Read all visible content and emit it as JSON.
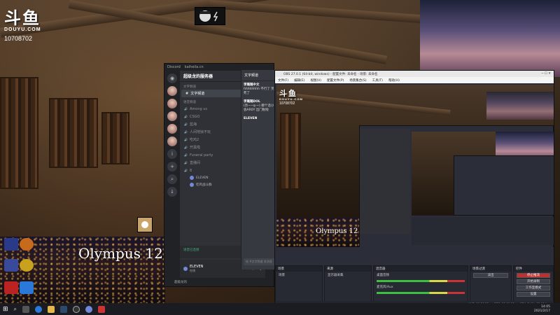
{
  "douyu": {
    "logo": "斗鱼",
    "domain": "DOUYU.COM",
    "room_id": "10708702"
  },
  "stream_overlay": {
    "title_text": "Olympus 12 I"
  },
  "discord": {
    "window_title": "Discord",
    "window_url": "kaiheila.cn",
    "server_name": "超级龙的服务器",
    "category_text": "文字频道",
    "category_voice": "语音频道",
    "text_channels": [
      {
        "name": "文字频道",
        "count": ""
      }
    ],
    "voice_channels": [
      {
        "name": "Among us",
        "count": "00/00"
      },
      {
        "name": "CSGO",
        "count": "00/00"
      },
      {
        "name": "蓝海",
        "count": "00/00"
      },
      {
        "name": "人间地狱不玩",
        "count": "00/00"
      },
      {
        "name": "吃鸡2",
        "count": "00/00"
      },
      {
        "name": "开黑啦",
        "count": "00/00"
      },
      {
        "name": "Funeral party",
        "count": "00/00"
      },
      {
        "name": "直播间",
        "count": "00/00"
      },
      {
        "name": "8",
        "count": "00/00"
      }
    ],
    "voice_users": [
      "ELEVEN",
      "吃鸡战斗群"
    ],
    "voice_status": "语音已连接",
    "user_name": "ELEVEN",
    "user_status": "在线",
    "chat_header": "文字频道",
    "messages": [
      {
        "name": "李璐璐中文",
        "text": "hhhhhhhh 不行了 笑死了"
      },
      {
        "name": "李璐璐DOL",
        "text": "(奈~~q-~) 哪个话小 会AR0Y 出门啦啦"
      },
      {
        "name": "ELEVEN",
        "text": ""
      }
    ],
    "input_placeholder": "给 #文字频道 发消息",
    "footer_text": "超级龙的"
  },
  "obs": {
    "title": "OBS 27.0.1 (64-bit, windows) - 配置文件: 未命名 - 场景: 未命名",
    "menu": [
      "文件(F)",
      "编辑(E)",
      "视图(V)",
      "配置文件(P)",
      "场景集合(S)",
      "工具(T)",
      "帮助(H)"
    ],
    "docks": {
      "scenes": "场景",
      "sources": "来源",
      "mixer": "混音器",
      "transitions": "场景过渡",
      "controls": "控件"
    },
    "scene_item": "场景",
    "source_item": "显示器采集",
    "mixer_items": [
      "桌面音频",
      "麦克风/Aux"
    ],
    "transition_value": "淡出",
    "controls": [
      "停止推流",
      "开始录制",
      "工作室模式",
      "设置",
      "退出"
    ],
    "status": [
      "LIVE: 00:36:12",
      "REC: 00:00:00",
      "CPU: 5.4%, 60.00 fps"
    ]
  },
  "taskbar": {
    "time": "14:05",
    "date": "2021/2/17"
  }
}
